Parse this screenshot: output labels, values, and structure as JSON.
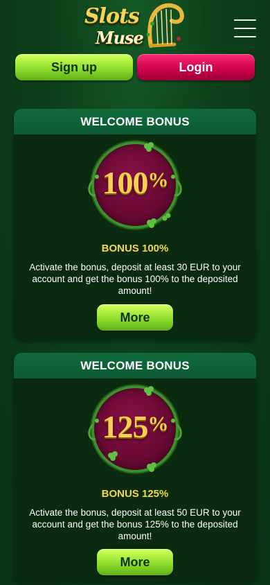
{
  "header": {
    "logo_line1": "Slots",
    "logo_line2": "Muse",
    "menu_icon": "hamburger-menu-icon"
  },
  "auth": {
    "signup_label": "Sign up",
    "login_label": "Login"
  },
  "bonuses": [
    {
      "heading": "WELCOME BONUS",
      "percent_number": "100",
      "percent_sign": "%",
      "title": "BONUS 100%",
      "description": "Activate the bonus, deposit at least 30 EUR to your account and get the bonus 100% to the deposited amount!",
      "button_label": "More"
    },
    {
      "heading": "WELCOME BONUS",
      "percent_number": "125",
      "percent_sign": "%",
      "title": "BONUS 125%",
      "description": "Activate the bonus, deposit at least 50 EUR to your account and get the bonus 125% to the deposited amount!",
      "button_label": "More"
    }
  ],
  "colors": {
    "background": "#0d3f1a",
    "card_header": "#0f6b3c",
    "card_body": "#0a2b10",
    "accent_green": "#8ee02c",
    "accent_pink": "#c9004a",
    "gold": "#f5d64c"
  }
}
